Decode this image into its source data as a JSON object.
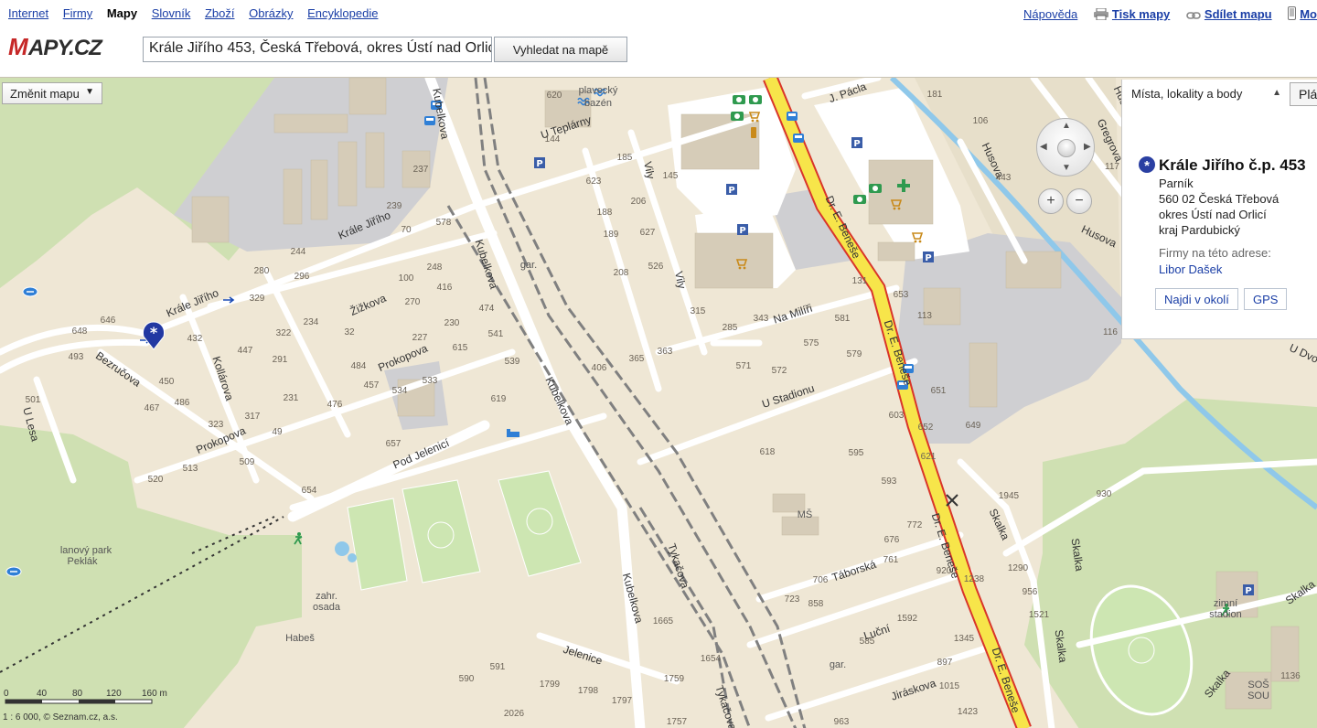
{
  "topnav": {
    "left_links": [
      "Internet",
      "Firmy",
      "Mapy",
      "Slovník",
      "Zboží",
      "Obrázky",
      "Encyklopedie"
    ],
    "active": "Mapy",
    "help": "Nápověda",
    "print": "Tisk mapy",
    "share": "Sdílet mapu",
    "mobile": "Mo"
  },
  "header": {
    "logo": "MAPY.CZ",
    "search_value": "Krále Jiřího 453, Česká Třebová, okres Ústí nad Orlicí",
    "search_button": "Vyhledat na mapě"
  },
  "map_controls": {
    "change_map": "Změnit mapu",
    "zoom_in": "+",
    "zoom_out": "−"
  },
  "panel": {
    "tab": "Místa, lokality a body",
    "tab2": "Plá",
    "title": "Krále Jiřího č.p. 453",
    "address_lines": [
      "Parník",
      "560 02 Česká Třebová",
      "okres Ústí nad Orlicí",
      "kraj Pardubický"
    ],
    "firms_label": "Firmy na této adrese:",
    "firm": "Libor Dašek",
    "btn_nearby": "Najdi v okolí",
    "btn_gps": "GPS"
  },
  "scale": {
    "ticks": [
      "0",
      "40",
      "80",
      "120",
      "160 m"
    ],
    "copyright": "1 : 6 000, © Seznam.cz, a.s."
  },
  "colors": {
    "map_background": "#efe7d5",
    "main_road": "#f7e54a",
    "main_road_border": "#d9352a",
    "link": "#1a3ea6",
    "forest": "#cfe0b2",
    "industrial": "#cfcfd2",
    "building": "#d6ccb8",
    "water": "#8fc8ea"
  },
  "streets": [
    {
      "name": "Krále Jiřího"
    },
    {
      "name": "Krále Jiřího"
    },
    {
      "name": "Kubelkova"
    },
    {
      "name": "Kubelkova"
    },
    {
      "name": "Kubelkova"
    },
    {
      "name": "Kubelkova"
    },
    {
      "name": "Žižkova"
    },
    {
      "name": "Prokopova"
    },
    {
      "name": "Prokopova"
    },
    {
      "name": "Bezručova"
    },
    {
      "name": "Kollárova"
    },
    {
      "name": "U Lesa"
    },
    {
      "name": "Pod Jelenicí"
    },
    {
      "name": "U Teplárny"
    },
    {
      "name": "Vily"
    },
    {
      "name": "Vily"
    },
    {
      "name": "Na Milíři"
    },
    {
      "name": "U Stadionu"
    },
    {
      "name": "Dr. E. Beneše"
    },
    {
      "name": "Dr. E. Beneše"
    },
    {
      "name": "Dr. E. Beneše"
    },
    {
      "name": "Dr. E. Beneše"
    },
    {
      "name": "J. Pácla"
    },
    {
      "name": "Husova"
    },
    {
      "name": "Husova"
    },
    {
      "name": "Husova"
    },
    {
      "name": "Gregrova"
    },
    {
      "name": "Tykačova"
    },
    {
      "name": "Tykačova"
    },
    {
      "name": "Táborská"
    },
    {
      "name": "Luční"
    },
    {
      "name": "Jiráskova"
    },
    {
      "name": "Jelenice"
    },
    {
      "name": "Skalka"
    },
    {
      "name": "Skalka"
    },
    {
      "name": "Skalka"
    },
    {
      "name": "Skalka"
    },
    {
      "name": "Skalka"
    },
    {
      "name": "U Dvo"
    }
  ],
  "places": [
    {
      "name": "lanový park"
    },
    {
      "name": "Peklák"
    },
    {
      "name": "zahr."
    },
    {
      "name": "osada"
    },
    {
      "name": "Habeš"
    },
    {
      "name": "gar."
    },
    {
      "name": "gar."
    },
    {
      "name": "MŠ"
    },
    {
      "name": "plavecký"
    },
    {
      "name": "bazén"
    },
    {
      "name": "zimní"
    },
    {
      "name": "stadion"
    },
    {
      "name": "SOŠ"
    },
    {
      "name": "SOU"
    }
  ],
  "house_numbers": [
    "620",
    "237",
    "239",
    "578",
    "70",
    "244",
    "296",
    "280",
    "100",
    "248",
    "416",
    "329",
    "270",
    "474",
    "322",
    "234",
    "32",
    "230",
    "646",
    "648",
    "432",
    "447",
    "291",
    "227",
    "615",
    "541",
    "493",
    "484",
    "457",
    "533",
    "534",
    "539",
    "450",
    "231",
    "619",
    "476",
    "467",
    "486",
    "317",
    "49",
    "501",
    "323",
    "657",
    "509",
    "520",
    "513",
    "654",
    "144",
    "185",
    "145",
    "623",
    "206",
    "188",
    "627",
    "189",
    "526",
    "208",
    "315",
    "285",
    "343",
    "363",
    "365",
    "406",
    "571",
    "572",
    "575",
    "581",
    "579",
    "131",
    "653",
    "113",
    "651",
    "649",
    "603",
    "652",
    "621",
    "618",
    "595",
    "593",
    "181",
    "106",
    "443",
    "117",
    "116",
    "1945",
    "930",
    "772",
    "676",
    "761",
    "920",
    "1238",
    "706",
    "858",
    "723",
    "1592",
    "585",
    "1345",
    "897",
    "1015",
    "1423",
    "963",
    "1290",
    "956",
    "1521",
    "1665",
    "1654",
    "1759",
    "1799",
    "1798",
    "1797",
    "1757",
    "590",
    "591",
    "2026",
    "1136"
  ]
}
